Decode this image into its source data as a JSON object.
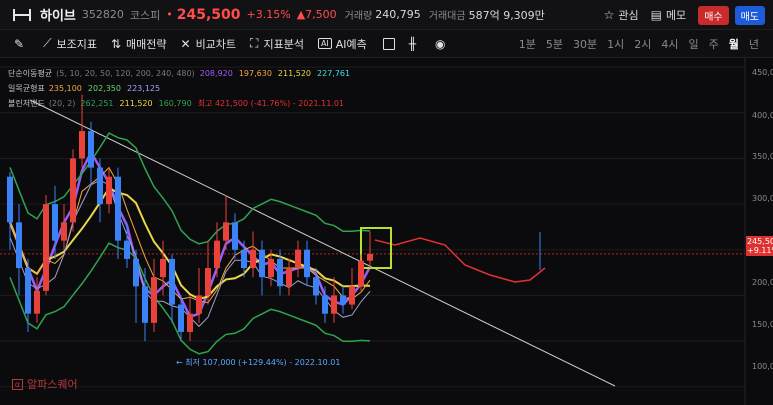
{
  "header": {
    "name": "하이브",
    "code": "352820",
    "market": "코스피",
    "dot": "•",
    "price": "245,500",
    "change_pct": "+3.15%",
    "change": "▲7,500",
    "volume_label": "거래량",
    "volume": "240,795",
    "amount_label": "거래대금",
    "amount": "587억 9,309만",
    "watch_label": "관심",
    "memo_label": "메모",
    "buy_label": "매수",
    "sell_label": "매도"
  },
  "toolbar": {
    "aux_label": "보조지표",
    "strategy_label": "매매전략",
    "compare_label": "비교차트",
    "analysis_label": "지표분석",
    "ai_badge": "AI",
    "ai_label": "AI예측",
    "periods": [
      "1분",
      "5분",
      "30분",
      "1시",
      "2시",
      "4시",
      "일",
      "주",
      "월",
      "년"
    ],
    "active_period": "월"
  },
  "legend": {
    "sma": {
      "title": "단순이동평균",
      "params": "(5, 10, 20, 50, 120, 200, 240, 480)",
      "values": [
        "208,920",
        "197,630",
        "211,520",
        "227,761"
      ],
      "colors": [
        "#9b5cf6",
        "#f5a742",
        "#e8d84a",
        "#3de0e6"
      ]
    },
    "ichimoku": {
      "title": "일목균형표",
      "values": [
        "235,100",
        "202,350",
        "223,125"
      ],
      "colors": [
        "#f5a742",
        "#6bd36b",
        "#a0a0ff"
      ]
    },
    "bollinger": {
      "title": "볼린저밴드",
      "params": "(20, 2)",
      "values": [
        "262,251",
        "211,520",
        "160,790"
      ],
      "colors": [
        "#2ea44f",
        "#e8d84a",
        "#2ea44f"
      ]
    },
    "high_note": "최고 421,500 (-41.76%) - 2021.11.01"
  },
  "annotations": {
    "low_note": "← 최저 107,000 (+129.44%) - 2022.10.01",
    "watermark": "알파스퀘어"
  },
  "axis": {
    "labels": [
      "450,000",
      "400,000",
      "350,000",
      "300,000",
      "200,000",
      "150,000",
      "100,000"
    ],
    "current_price": "245,500",
    "current_pct": "+9.11%"
  },
  "chart_data": {
    "type": "candlestick",
    "ylim": [
      80000,
      460000
    ],
    "candles": [
      [
        330000,
        280000,
        335000,
        250000
      ],
      [
        280000,
        230000,
        300000,
        200000
      ],
      [
        230000,
        180000,
        240000,
        160000
      ],
      [
        180000,
        205000,
        220000,
        170000
      ],
      [
        205000,
        300000,
        310000,
        200000
      ],
      [
        300000,
        260000,
        320000,
        240000
      ],
      [
        260000,
        280000,
        300000,
        250000
      ],
      [
        280000,
        350000,
        360000,
        270000
      ],
      [
        350000,
        380000,
        420000,
        340000
      ],
      [
        380000,
        340000,
        390000,
        320000
      ],
      [
        340000,
        300000,
        350000,
        280000
      ],
      [
        300000,
        330000,
        340000,
        290000
      ],
      [
        330000,
        260000,
        340000,
        240000
      ],
      [
        260000,
        240000,
        280000,
        230000
      ],
      [
        240000,
        210000,
        250000,
        170000
      ],
      [
        210000,
        170000,
        230000,
        150000
      ],
      [
        170000,
        220000,
        240000,
        160000
      ],
      [
        220000,
        240000,
        260000,
        200000
      ],
      [
        240000,
        190000,
        245000,
        170000
      ],
      [
        190000,
        160000,
        200000,
        150000
      ],
      [
        160000,
        180000,
        200000,
        150000
      ],
      [
        180000,
        200000,
        230000,
        170000
      ],
      [
        200000,
        230000,
        260000,
        190000
      ],
      [
        230000,
        260000,
        280000,
        220000
      ],
      [
        260000,
        280000,
        310000,
        250000
      ],
      [
        280000,
        250000,
        290000,
        240000
      ],
      [
        250000,
        230000,
        260000,
        220000
      ],
      [
        230000,
        250000,
        270000,
        220000
      ],
      [
        250000,
        220000,
        260000,
        200000
      ],
      [
        220000,
        240000,
        250000,
        210000
      ],
      [
        240000,
        210000,
        250000,
        200000
      ],
      [
        210000,
        230000,
        240000,
        200000
      ],
      [
        230000,
        250000,
        260000,
        220000
      ],
      [
        250000,
        220000,
        260000,
        210000
      ],
      [
        220000,
        200000,
        230000,
        190000
      ],
      [
        200000,
        180000,
        210000,
        170000
      ],
      [
        180000,
        200000,
        220000,
        170000
      ],
      [
        200000,
        190000,
        210000,
        180000
      ],
      [
        190000,
        210000,
        230000,
        185000
      ],
      [
        210000,
        238000,
        245000,
        205000
      ],
      [
        238000,
        245500,
        270000,
        230000
      ]
    ]
  }
}
